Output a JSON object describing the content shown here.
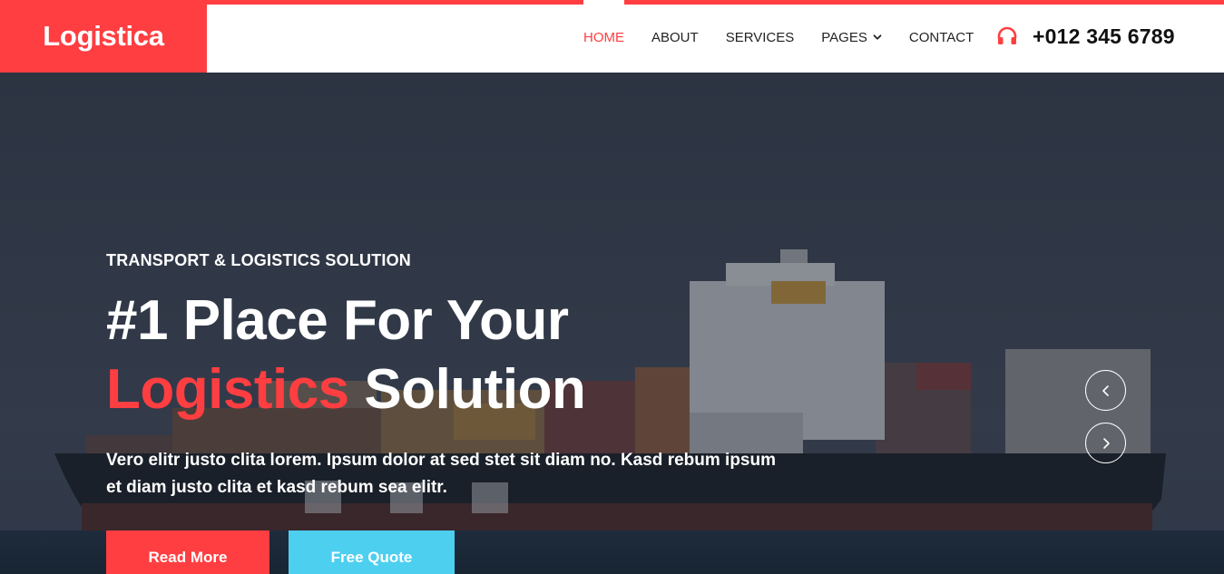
{
  "brand": {
    "name": "Logistica"
  },
  "nav": {
    "items": [
      {
        "label": "HOME",
        "active": true
      },
      {
        "label": "ABOUT",
        "active": false
      },
      {
        "label": "SERVICES",
        "active": false
      },
      {
        "label": "PAGES",
        "active": false,
        "dropdown": true
      },
      {
        "label": "CONTACT",
        "active": false
      }
    ]
  },
  "contact": {
    "phone": "+012 345 6789",
    "icon": "headphones-icon"
  },
  "hero": {
    "kicker": "TRANSPORT & LOGISTICS SOLUTION",
    "headline_line1": "#1 Place For Your",
    "headline_accent": "Logistics",
    "headline_rest": "Solution",
    "lead": "Vero elitr justo clita lorem. Ipsum dolor at sed stet sit diam no. Kasd rebum ipsum et diam justo clita et kasd rebum sea elitr.",
    "buttons": {
      "read_more": "Read More",
      "free_quote": "Free Quote"
    },
    "carousel": {
      "prev_icon": "chevron-left-icon",
      "next_icon": "chevron-right-icon"
    }
  },
  "colors": {
    "primary": "#FF3E41",
    "secondary": "#4DCFEF",
    "dark": "#232323"
  }
}
